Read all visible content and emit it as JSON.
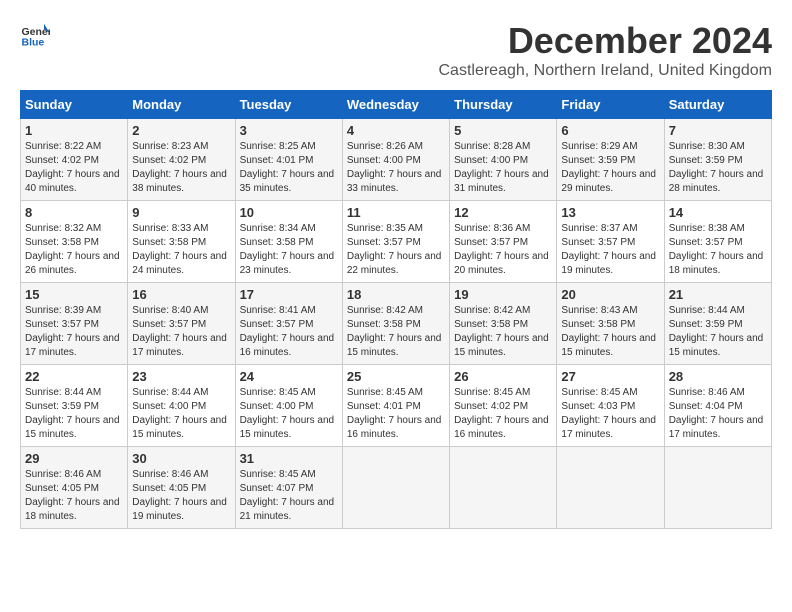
{
  "header": {
    "logo_general": "General",
    "logo_blue": "Blue",
    "main_title": "December 2024",
    "subtitle": "Castlereagh, Northern Ireland, United Kingdom"
  },
  "calendar": {
    "days_of_week": [
      "Sunday",
      "Monday",
      "Tuesday",
      "Wednesday",
      "Thursday",
      "Friday",
      "Saturday"
    ],
    "weeks": [
      [
        {
          "day": "",
          "info": ""
        },
        {
          "day": "",
          "info": ""
        },
        {
          "day": "",
          "info": ""
        },
        {
          "day": "",
          "info": ""
        },
        {
          "day": "",
          "info": ""
        },
        {
          "day": "",
          "info": ""
        },
        {
          "day": "",
          "info": ""
        }
      ]
    ],
    "cells": [
      {
        "day": "1",
        "sunrise": "8:22 AM",
        "sunset": "4:02 PM",
        "daylight": "7 hours and 40 minutes."
      },
      {
        "day": "2",
        "sunrise": "8:23 AM",
        "sunset": "4:02 PM",
        "daylight": "7 hours and 38 minutes."
      },
      {
        "day": "3",
        "sunrise": "8:25 AM",
        "sunset": "4:01 PM",
        "daylight": "7 hours and 35 minutes."
      },
      {
        "day": "4",
        "sunrise": "8:26 AM",
        "sunset": "4:00 PM",
        "daylight": "7 hours and 33 minutes."
      },
      {
        "day": "5",
        "sunrise": "8:28 AM",
        "sunset": "4:00 PM",
        "daylight": "7 hours and 31 minutes."
      },
      {
        "day": "6",
        "sunrise": "8:29 AM",
        "sunset": "3:59 PM",
        "daylight": "7 hours and 29 minutes."
      },
      {
        "day": "7",
        "sunrise": "8:30 AM",
        "sunset": "3:59 PM",
        "daylight": "7 hours and 28 minutes."
      },
      {
        "day": "8",
        "sunrise": "8:32 AM",
        "sunset": "3:58 PM",
        "daylight": "7 hours and 26 minutes."
      },
      {
        "day": "9",
        "sunrise": "8:33 AM",
        "sunset": "3:58 PM",
        "daylight": "7 hours and 24 minutes."
      },
      {
        "day": "10",
        "sunrise": "8:34 AM",
        "sunset": "3:58 PM",
        "daylight": "7 hours and 23 minutes."
      },
      {
        "day": "11",
        "sunrise": "8:35 AM",
        "sunset": "3:57 PM",
        "daylight": "7 hours and 22 minutes."
      },
      {
        "day": "12",
        "sunrise": "8:36 AM",
        "sunset": "3:57 PM",
        "daylight": "7 hours and 20 minutes."
      },
      {
        "day": "13",
        "sunrise": "8:37 AM",
        "sunset": "3:57 PM",
        "daylight": "7 hours and 19 minutes."
      },
      {
        "day": "14",
        "sunrise": "8:38 AM",
        "sunset": "3:57 PM",
        "daylight": "7 hours and 18 minutes."
      },
      {
        "day": "15",
        "sunrise": "8:39 AM",
        "sunset": "3:57 PM",
        "daylight": "7 hours and 17 minutes."
      },
      {
        "day": "16",
        "sunrise": "8:40 AM",
        "sunset": "3:57 PM",
        "daylight": "7 hours and 17 minutes."
      },
      {
        "day": "17",
        "sunrise": "8:41 AM",
        "sunset": "3:57 PM",
        "daylight": "7 hours and 16 minutes."
      },
      {
        "day": "18",
        "sunrise": "8:42 AM",
        "sunset": "3:58 PM",
        "daylight": "7 hours and 15 minutes."
      },
      {
        "day": "19",
        "sunrise": "8:42 AM",
        "sunset": "3:58 PM",
        "daylight": "7 hours and 15 minutes."
      },
      {
        "day": "20",
        "sunrise": "8:43 AM",
        "sunset": "3:58 PM",
        "daylight": "7 hours and 15 minutes."
      },
      {
        "day": "21",
        "sunrise": "8:44 AM",
        "sunset": "3:59 PM",
        "daylight": "7 hours and 15 minutes."
      },
      {
        "day": "22",
        "sunrise": "8:44 AM",
        "sunset": "3:59 PM",
        "daylight": "7 hours and 15 minutes."
      },
      {
        "day": "23",
        "sunrise": "8:44 AM",
        "sunset": "4:00 PM",
        "daylight": "7 hours and 15 minutes."
      },
      {
        "day": "24",
        "sunrise": "8:45 AM",
        "sunset": "4:00 PM",
        "daylight": "7 hours and 15 minutes."
      },
      {
        "day": "25",
        "sunrise": "8:45 AM",
        "sunset": "4:01 PM",
        "daylight": "7 hours and 16 minutes."
      },
      {
        "day": "26",
        "sunrise": "8:45 AM",
        "sunset": "4:02 PM",
        "daylight": "7 hours and 16 minutes."
      },
      {
        "day": "27",
        "sunrise": "8:45 AM",
        "sunset": "4:03 PM",
        "daylight": "7 hours and 17 minutes."
      },
      {
        "day": "28",
        "sunrise": "8:46 AM",
        "sunset": "4:04 PM",
        "daylight": "7 hours and 17 minutes."
      },
      {
        "day": "29",
        "sunrise": "8:46 AM",
        "sunset": "4:05 PM",
        "daylight": "7 hours and 18 minutes."
      },
      {
        "day": "30",
        "sunrise": "8:46 AM",
        "sunset": "4:05 PM",
        "daylight": "7 hours and 19 minutes."
      },
      {
        "day": "31",
        "sunrise": "8:45 AM",
        "sunset": "4:07 PM",
        "daylight": "7 hours and 21 minutes."
      }
    ]
  }
}
